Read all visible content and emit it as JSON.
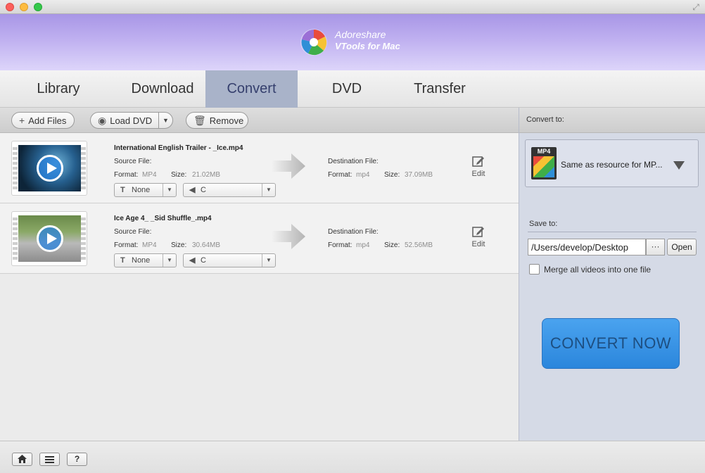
{
  "window": {
    "fullscreen_icon": "fullscreen-arrows-icon"
  },
  "brand": {
    "name": "Adoreshare",
    "product": "VTools for Mac",
    "logo_icon": "pinwheel-logo-icon"
  },
  "tabs": [
    {
      "label": "Library",
      "active": false
    },
    {
      "label": "Download",
      "active": false
    },
    {
      "label": "Convert",
      "active": true
    },
    {
      "label": "DVD",
      "active": false
    },
    {
      "label": "Transfer",
      "active": false
    }
  ],
  "toolbar": {
    "add_files": "Add Files",
    "load_dvd": "Load DVD",
    "remove": "Remove"
  },
  "files": [
    {
      "name": "International English Trailer - _Ice.mp4",
      "source_label": "Source File:",
      "format_label": "Format:",
      "source_format": "MP4",
      "size_label": "Size:",
      "source_size": "21.02MB",
      "dest_label": "Destination File:",
      "dest_format": "mp4",
      "dest_size": "37.09MB",
      "subtitle": "None",
      "audio": "C",
      "edit_label": "Edit"
    },
    {
      "name": "Ice Age 4_ _Sid Shuffle_.mp4",
      "source_label": "Source File:",
      "format_label": "Format:",
      "source_format": "MP4",
      "size_label": "Size:",
      "source_size": "30.64MB",
      "dest_label": "Destination File:",
      "dest_format": "mp4",
      "dest_size": "52.56MB",
      "subtitle": "None",
      "audio": "C",
      "edit_label": "Edit"
    }
  ],
  "right_panel": {
    "convert_to_label": "Convert to:",
    "format_badge": "MP4",
    "format_text": "Same as resource for MP...",
    "save_to_label": "Save to:",
    "save_path": "/Users/develop/Desktop",
    "browse_label": "···",
    "open_label": "Open",
    "merge_label": "Merge all videos into one file",
    "merge_checked": false,
    "convert_now": "CONVERT NOW"
  },
  "footer": {
    "help_label": "?"
  },
  "colors": {
    "accent_tab": "#a9b3c9",
    "convert_button": "#2b86dc",
    "banner": "#bfb0f0"
  }
}
